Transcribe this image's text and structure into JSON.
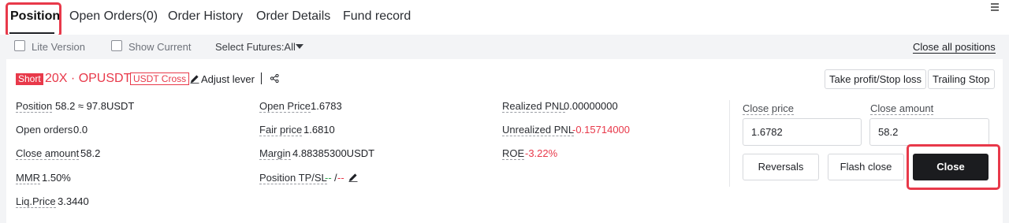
{
  "tabs": [
    {
      "label": "Position",
      "active": true
    },
    {
      "label": "Open Orders(0)"
    },
    {
      "label": "Order History"
    },
    {
      "label": "Order Details"
    },
    {
      "label": "Fund record"
    }
  ],
  "filters": {
    "lite_version": "Lite Version",
    "show_current": "Show Current",
    "select_futures": "Select Futures:All",
    "close_all": "Close all positions"
  },
  "position": {
    "side_tag": "Short",
    "title": "20X · OPUSDT",
    "margin_tag": "USDT Cross",
    "adjust_lever": "Adjust lever",
    "tp_sl_button": "Take profit/Stop loss",
    "trailing_stop_button": "Trailing Stop",
    "fields": {
      "position": {
        "label": "Position",
        "value": "58.2 ≈ 97.8USDT"
      },
      "open_orders": {
        "label": "Open orders",
        "value": "0.0"
      },
      "close_amount": {
        "label": "Close amount",
        "value": "58.2"
      },
      "mmr": {
        "label": "MMR",
        "value": "1.50%"
      },
      "liq_price": {
        "label": "Liq.Price",
        "value": "3.3440"
      },
      "open_price": {
        "label": "Open Price",
        "value": "1.6783"
      },
      "fair_price": {
        "label": "Fair price",
        "value": "1.6810"
      },
      "margin": {
        "label": "Margin",
        "value": "4.88385300USDT"
      },
      "position_tpsl": {
        "label": "Position TP/SL",
        "tp": "--",
        "sep": "/",
        "sl": "--"
      },
      "realized_pnl": {
        "label": "Realized PNL",
        "value": "0.00000000"
      },
      "unrealized_pnl": {
        "label": "Unrealized PNL",
        "value": "-0.15714000"
      },
      "roe": {
        "label": "ROE",
        "value": "-3.22%"
      }
    }
  },
  "close_panel": {
    "close_price_label": "Close price",
    "close_price_value": "1.6782",
    "close_amount_label": "Close amount",
    "close_amount_value": "58.2",
    "reversals": "Reversals",
    "flash_close": "Flash close",
    "close": "Close"
  },
  "colors": {
    "accent_red": "#e8394a",
    "profit_green": "#2ea44f",
    "close_button": "#1b1c1f"
  }
}
